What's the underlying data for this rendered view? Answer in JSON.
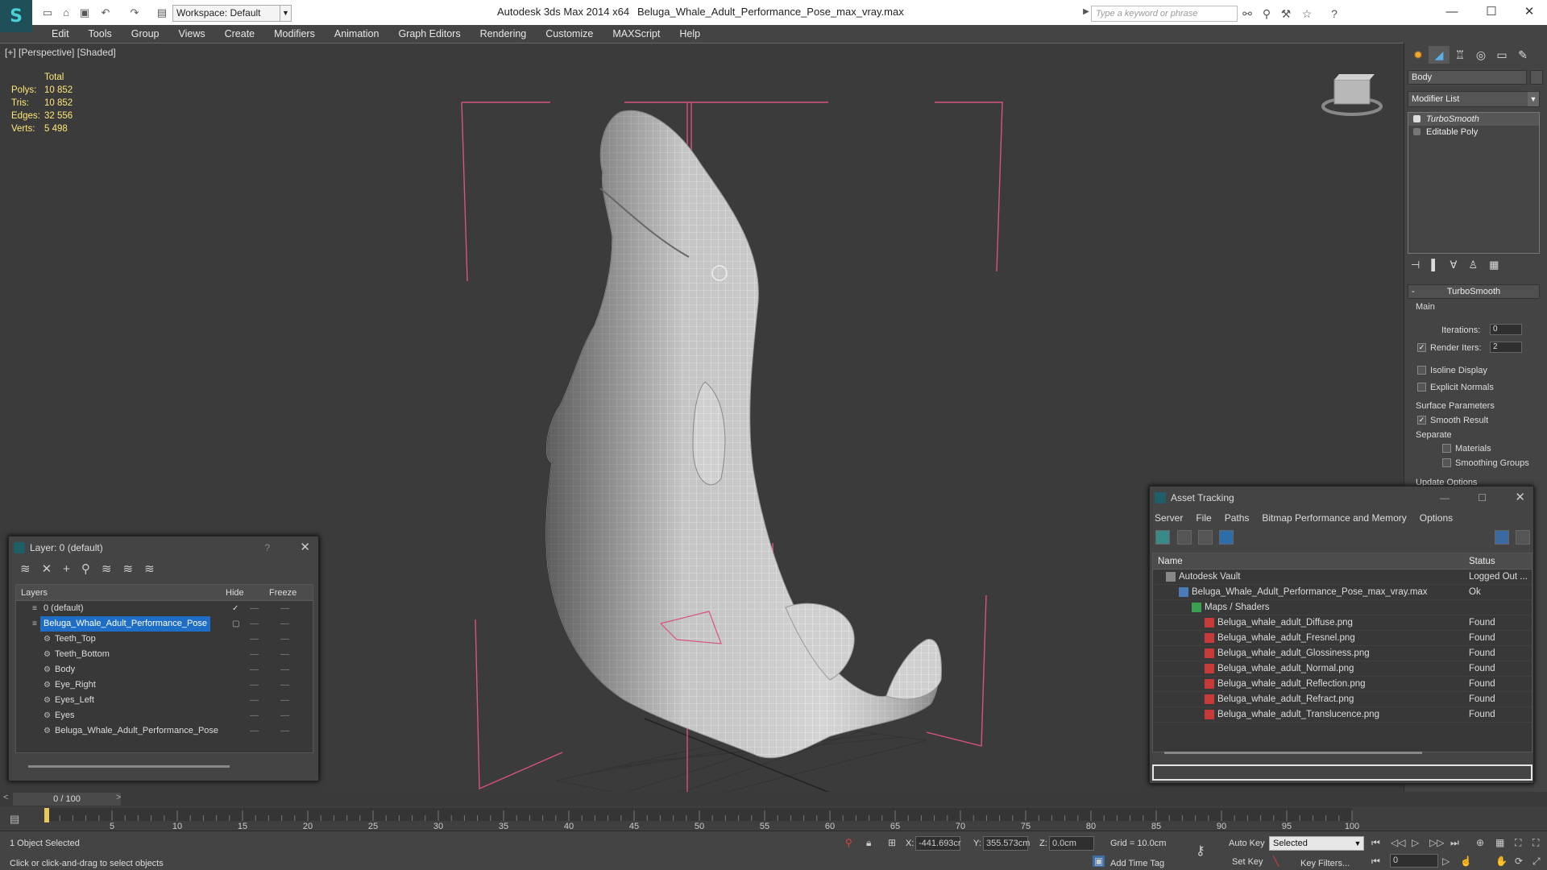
{
  "title_bar": {
    "workspace": "Workspace: Default",
    "app_title": "Autodesk 3ds Max  2014 x64",
    "file_title": "Beluga_Whale_Adult_Performance_Pose_max_vray.max",
    "search_placeholder": "Type a keyword or phrase"
  },
  "menu": [
    "Edit",
    "Tools",
    "Group",
    "Views",
    "Create",
    "Modifiers",
    "Animation",
    "Graph Editors",
    "Rendering",
    "Customize",
    "MAXScript",
    "Help"
  ],
  "viewport": {
    "label": "[+] [Perspective] [Shaded]",
    "stats": {
      "header": "Total",
      "rows": [
        {
          "label": "Polys:",
          "value": "10 852"
        },
        {
          "label": "Tris:",
          "value": "10 852"
        },
        {
          "label": "Edges:",
          "value": "32 556"
        },
        {
          "label": "Verts:",
          "value": "5 498"
        }
      ]
    },
    "bg_color": "#3b3b3b",
    "bbox_color": "#d8537f"
  },
  "command_panel": {
    "object_name": "Body",
    "modifier_list": "Modifier List",
    "stack": [
      "TurboSmooth",
      "Editable Poly"
    ],
    "turbosmooth": {
      "title": "TurboSmooth",
      "main": "Main",
      "iterations_label": "Iterations:",
      "iterations_value": "0",
      "render_iters_label": "Render Iters:",
      "render_iters_value": "2",
      "isoline": "Isoline Display",
      "explicit_normals": "Explicit Normals",
      "surface_params": "Surface Parameters",
      "smooth_result": "Smooth Result",
      "separate": "Separate",
      "materials": "Materials",
      "smoothing_groups": "Smoothing Groups",
      "update_options": "Update Options"
    }
  },
  "layer_dialog": {
    "title": "Layer: 0 (default)",
    "help": "?",
    "columns": {
      "layers": "Layers",
      "hide": "Hide",
      "freeze": "Freeze"
    },
    "rows": [
      {
        "name": "0 (default)",
        "indent": 0
      },
      {
        "name": "Beluga_Whale_Adult_Performance_Pose",
        "indent": 0,
        "selected": true
      },
      {
        "name": "Teeth_Top",
        "indent": 1
      },
      {
        "name": "Teeth_Bottom",
        "indent": 1
      },
      {
        "name": "Body",
        "indent": 1
      },
      {
        "name": "Eye_Right",
        "indent": 1
      },
      {
        "name": "Eyes_Left",
        "indent": 1
      },
      {
        "name": "Eyes",
        "indent": 1
      },
      {
        "name": "Beluga_Whale_Adult_Performance_Pose",
        "indent": 1
      }
    ]
  },
  "asset_tracking": {
    "title": "Asset Tracking",
    "menu": [
      "Server",
      "File",
      "Paths",
      "Bitmap Performance and Memory",
      "Options"
    ],
    "columns": {
      "name": "Name",
      "status": "Status"
    },
    "rows": [
      {
        "name": "Autodesk Vault",
        "status": "Logged Out ...",
        "indent": 1,
        "icon": "vault"
      },
      {
        "name": "Beluga_Whale_Adult_Performance_Pose_max_vray.max",
        "status": "Ok",
        "indent": 2,
        "icon": "max"
      },
      {
        "name": "Maps / Shaders",
        "status": "",
        "indent": 3,
        "icon": "folder"
      },
      {
        "name": "Beluga_whale_adult_Diffuse.png",
        "status": "Found",
        "indent": 4,
        "icon": "png"
      },
      {
        "name": "Beluga_whale_adult_Fresnel.png",
        "status": "Found",
        "indent": 4,
        "icon": "png"
      },
      {
        "name": "Beluga_whale_adult_Glossiness.png",
        "status": "Found",
        "indent": 4,
        "icon": "png"
      },
      {
        "name": "Beluga_whale_adult_Normal.png",
        "status": "Found",
        "indent": 4,
        "icon": "png"
      },
      {
        "name": "Beluga_whale_adult_Reflection.png",
        "status": "Found",
        "indent": 4,
        "icon": "png"
      },
      {
        "name": "Beluga_whale_adult_Refract.png",
        "status": "Found",
        "indent": 4,
        "icon": "png"
      },
      {
        "name": "Beluga_whale_adult_Translucence.png",
        "status": "Found",
        "indent": 4,
        "icon": "png"
      }
    ]
  },
  "timeline": {
    "frame_display": "0 / 100",
    "ticks": [
      "5",
      "10",
      "15",
      "20",
      "25",
      "30",
      "35",
      "40",
      "45",
      "50",
      "55",
      "60",
      "65",
      "70",
      "75",
      "80",
      "85",
      "90",
      "95",
      "100"
    ]
  },
  "status_bar": {
    "selection": "1 Object Selected",
    "prompt": "Click or click-and-drag to select objects",
    "x_label": "X:",
    "x_value": "-441.693cr",
    "y_label": "Y:",
    "y_value": "355.573cm",
    "z_label": "Z:",
    "z_value": "0.0cm",
    "grid": "Grid = 10.0cm",
    "add_time_tag": "Add Time Tag",
    "auto_key": "Auto Key",
    "set_key": "Set Key",
    "selected_option": "Selected",
    "key_filters": "Key Filters...",
    "current_frame": "0"
  }
}
